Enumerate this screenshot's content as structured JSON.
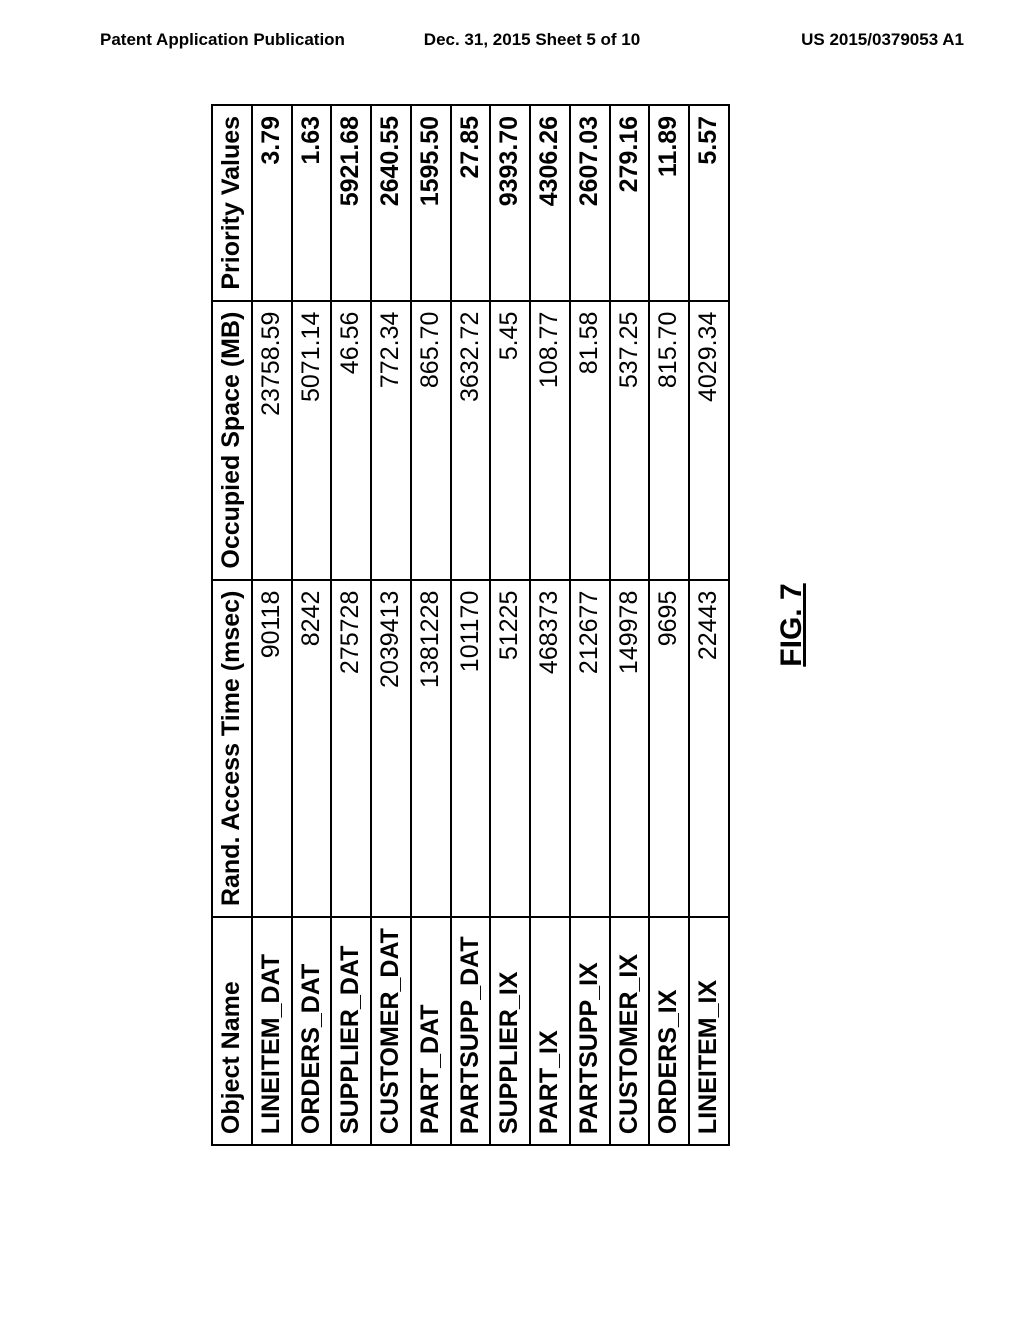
{
  "header": {
    "left": "Patent Application Publication",
    "center": "Dec. 31, 2015   Sheet 5 of 10",
    "right": "US 2015/0379053 A1"
  },
  "figure_caption": "FIG. 7",
  "chart_data": {
    "type": "table",
    "columns": [
      "Object Name",
      "Rand. Access Time (msec)",
      "Occupied Space (MB)",
      "Priority Values"
    ],
    "rows": [
      {
        "object": "LINEITEM_DAT",
        "rat": "90118",
        "space": "23758.59",
        "pv": "3.79"
      },
      {
        "object": "ORDERS_DAT",
        "rat": "8242",
        "space": "5071.14",
        "pv": "1.63"
      },
      {
        "object": "SUPPLIER_DAT",
        "rat": "275728",
        "space": "46.56",
        "pv": "5921.68"
      },
      {
        "object": "CUSTOMER_DAT",
        "rat": "2039413",
        "space": "772.34",
        "pv": "2640.55"
      },
      {
        "object": "PART_DAT",
        "rat": "1381228",
        "space": "865.70",
        "pv": "1595.50"
      },
      {
        "object": "PARTSUPP_DAT",
        "rat": "101170",
        "space": "3632.72",
        "pv": "27.85"
      },
      {
        "object": "SUPPLIER_IX",
        "rat": "51225",
        "space": "5.45",
        "pv": "9393.70"
      },
      {
        "object": "PART_IX",
        "rat": "468373",
        "space": "108.77",
        "pv": "4306.26"
      },
      {
        "object": "PARTSUPP_IX",
        "rat": "212677",
        "space": "81.58",
        "pv": "2607.03"
      },
      {
        "object": "CUSTOMER_IX",
        "rat": "149978",
        "space": "537.25",
        "pv": "279.16"
      },
      {
        "object": "ORDERS_IX",
        "rat": "9695",
        "space": "815.70",
        "pv": "11.89"
      },
      {
        "object": "LINEITEM_IX",
        "rat": "22443",
        "space": "4029.34",
        "pv": "5.57"
      }
    ]
  }
}
